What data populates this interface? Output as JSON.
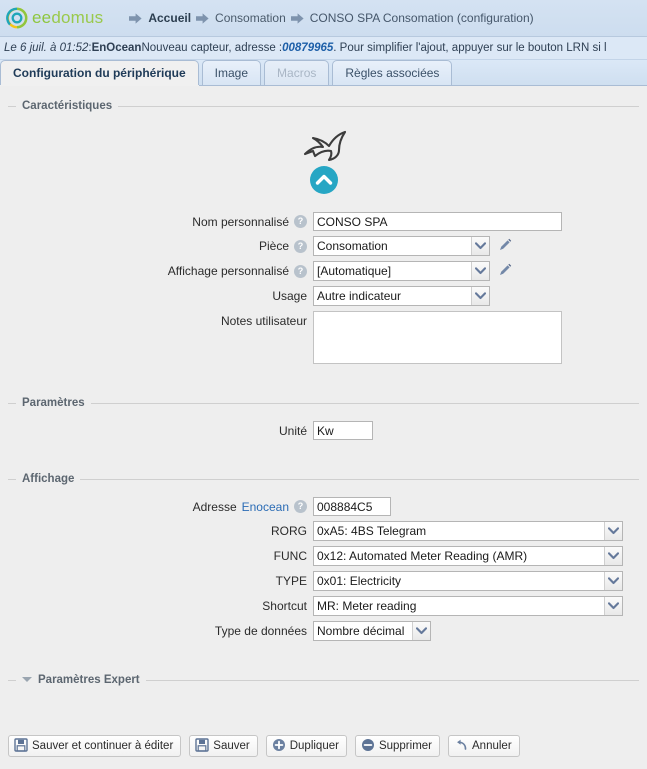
{
  "header": {
    "logo_text_part1": "ee",
    "logo_text_part2": "domus",
    "breadcrumbs": [
      {
        "label": "Accueil"
      },
      {
        "label": "Consomation"
      },
      {
        "label": "CONSO SPA Consomation (configuration)"
      }
    ]
  },
  "notice": {
    "date": "Le 6 juil. à 01:52",
    "separator": " : ",
    "protocol": "EnOcean",
    "text_before": " Nouveau capteur, adresse : ",
    "address": "00879965",
    "text_after": ". Pour simplifier l'ajout, appuyer sur le bouton LRN si l"
  },
  "tabs": [
    {
      "label": "Configuration du périphérique",
      "state": "active"
    },
    {
      "label": "Image",
      "state": "normal"
    },
    {
      "label": "Macros",
      "state": "disabled"
    },
    {
      "label": "Règles associées",
      "state": "normal"
    }
  ],
  "sections": {
    "caracteristiques": {
      "legend": "Caractéristiques",
      "device_icon": "dolphin-icon",
      "badge_icon": "chevron-up-icon",
      "fields": {
        "nom": {
          "label": "Nom personnalisé",
          "value": "CONSO SPA",
          "help": "?"
        },
        "piece": {
          "label": "Pièce",
          "value": "Consomation",
          "help": "?",
          "edit_icon": "pencil-icon"
        },
        "affichage": {
          "label": "Affichage personnalisé",
          "value": "[Automatique]",
          "help": "?",
          "edit_icon": "pencil-icon"
        },
        "usage": {
          "label": "Usage",
          "value": "Autre indicateur"
        },
        "notes": {
          "label": "Notes utilisateur",
          "value": ""
        }
      }
    },
    "parametres": {
      "legend": "Paramètres",
      "fields": {
        "unite": {
          "label": "Unité",
          "value": "Kw"
        }
      }
    },
    "affichage": {
      "legend": "Affichage",
      "fields": {
        "adresse": {
          "label_prefix": "Adresse ",
          "label_link": "Enocean",
          "value": "008884C5",
          "help": "?"
        },
        "rorg": {
          "label": "RORG",
          "value": "0xA5: 4BS Telegram"
        },
        "func": {
          "label": "FUNC",
          "value": "0x12: Automated Meter Reading (AMR)"
        },
        "type": {
          "label": "TYPE",
          "value": "0x01: Electricity"
        },
        "shortcut": {
          "label": "Shortcut",
          "value": "MR: Meter reading"
        },
        "type_donnees": {
          "label": "Type de données",
          "value": "Nombre décimal"
        }
      }
    },
    "expert": {
      "legend": "Paramètres Expert",
      "collapse_icon": "triangle-down-icon"
    }
  },
  "buttons": [
    {
      "label": "Sauver et continuer à éditer",
      "icon": "floppy-disk-icon"
    },
    {
      "label": "Sauver",
      "icon": "floppy-disk-icon"
    },
    {
      "label": "Dupliquer",
      "icon": "circle-plus-icon"
    },
    {
      "label": "Supprimer",
      "icon": "circle-minus-icon"
    },
    {
      "label": "Annuler",
      "icon": "undo-arrow-icon"
    }
  ],
  "colors": {
    "accent_teal": "#26a6c4",
    "link_blue": "#2b6cb5",
    "header_blue": "#d4e2f2",
    "icon_blue_gray": "#6b80a0"
  }
}
